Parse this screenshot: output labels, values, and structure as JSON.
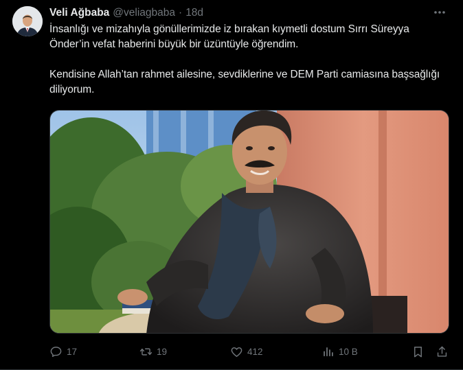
{
  "author": {
    "display_name": "Veli Ağbaba",
    "handle": "@veliagbaba",
    "separator": "·",
    "time": "18d",
    "avatar_icon": "avatar-photo"
  },
  "tweet": {
    "paragraph1": "İnsanlığı ve mizahıyla gönüllerimizde iz bırakan kıymetli dostum Sırrı Süreyya Önder’in vefat haberini büyük bir üzüntüyle öğrendim.",
    "paragraph2": "Kendisine Allah’tan rahmet ailesine, sevdiklerine ve DEM Parti camiasına başsağlığı diliyorum."
  },
  "actions": {
    "reply_count": "17",
    "retweet_count": "19",
    "like_count": "412",
    "views_count": "10 B"
  },
  "icons": {
    "more": "more-horizontal-icon",
    "reply": "reply-icon",
    "retweet": "retweet-icon",
    "like": "heart-icon",
    "views": "views-icon",
    "bookmark": "bookmark-icon",
    "share": "share-icon"
  },
  "colors": {
    "background": "#000000",
    "text_primary": "#e7e9ea",
    "text_secondary": "#71767b",
    "border": "#2f3336"
  }
}
